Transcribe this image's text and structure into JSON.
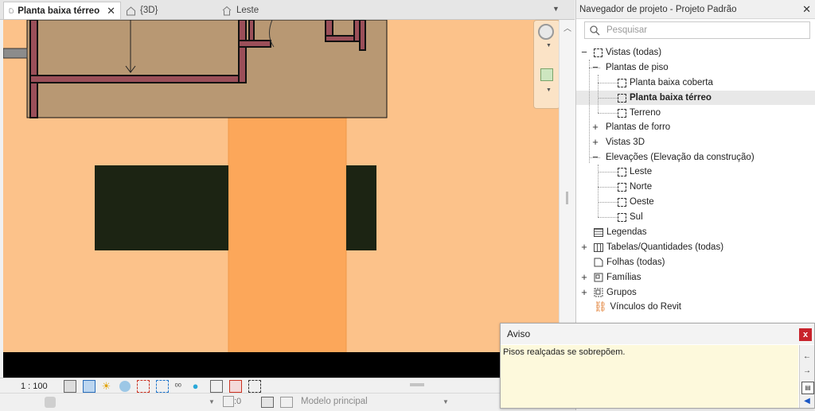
{
  "tabs": [
    {
      "label": "Planta baixa térreo",
      "active": true,
      "icon": "floor-plan-icon"
    },
    {
      "label": "{3D}",
      "active": false,
      "icon": "house-3d-icon"
    },
    {
      "label": "Leste",
      "active": false,
      "icon": "elevation-icon"
    }
  ],
  "status": {
    "scale": "1 : 100",
    "workset_value": ":0",
    "model": "Modelo principal"
  },
  "browser": {
    "title": "Navegador de projeto - Projeto Padrão",
    "search_placeholder": "Pesquisar",
    "tree": {
      "views": "Vistas (todas)",
      "floor_plans": "Plantas de piso",
      "fp_items": [
        "Planta baixa coberta",
        "Planta baixa térreo",
        "Terreno"
      ],
      "ceiling_plans": "Plantas de forro",
      "views_3d": "Vistas 3D",
      "elevations": "Elevações (Elevação da construção)",
      "elev_items": [
        "Leste",
        "Norte",
        "Oeste",
        "Sul"
      ],
      "legends": "Legendas",
      "schedules": "Tabelas/Quantidades (todas)",
      "sheets": "Folhas (todas)",
      "families": "Famílias",
      "groups": "Grupos",
      "links": "Vínculos do Revit"
    }
  },
  "warning": {
    "title": "Aviso",
    "close_label": "x",
    "message": "Pisos realçadas se sobrepõem."
  },
  "colors": {
    "viewport_bg": "#fcc28a",
    "highlight_strip": "#fca75a",
    "wall_fill": "#9b4f59",
    "roof_fill": "#b89873",
    "dark_block": "#1c2413",
    "dialog_close": "#c8232c"
  }
}
